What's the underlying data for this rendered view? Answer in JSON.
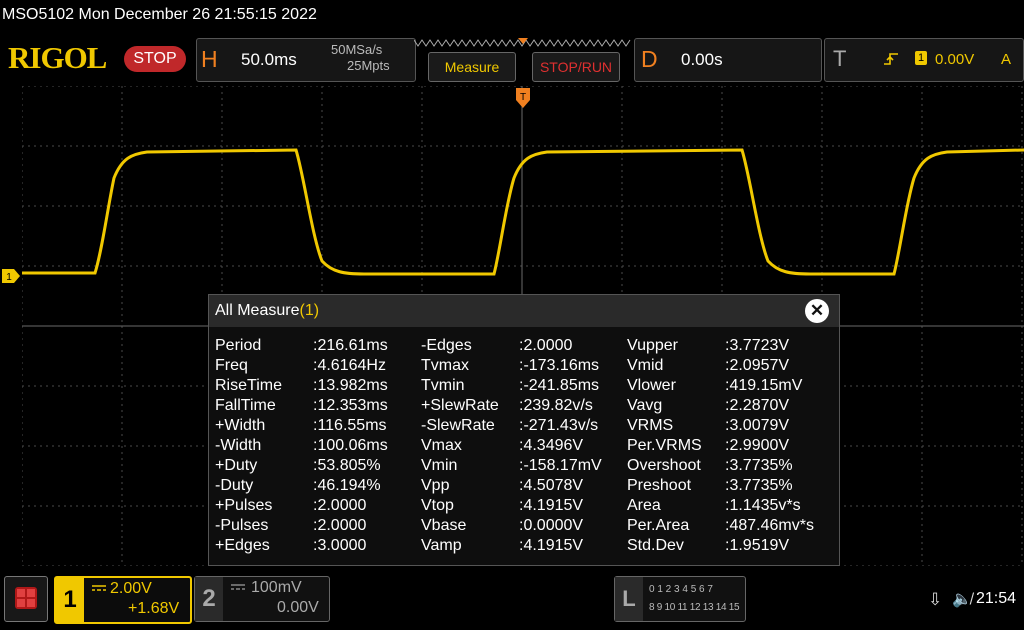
{
  "window_title": "MSO5102  Mon December 26 21:55:15 2022",
  "brand": "RIGOL",
  "run_state": "STOP",
  "horizontal": {
    "letter": "H",
    "timebase": "50.0ms",
    "sample_rate": "50MSa/s",
    "memory_depth": "25Mpts"
  },
  "buttons": {
    "measure": "Measure",
    "stop_run": "STOP/RUN"
  },
  "delay": {
    "letter": "D",
    "value": "0.00s"
  },
  "trigger": {
    "letter": "T",
    "source": "1",
    "level": "0.00V",
    "mode": "A"
  },
  "channel_marker": "1",
  "trigger_marker": "T",
  "colors": {
    "ch1": "#f0c800",
    "stop": "#c0282a",
    "accent": "#f08020",
    "grid": "#555555"
  },
  "measure_panel": {
    "title": "All Measure",
    "count": "(1)",
    "close": "✕",
    "columns": [
      [
        [
          "Period",
          ":216.61ms"
        ],
        [
          "Freq",
          ":4.6164Hz"
        ],
        [
          "RiseTime",
          ":13.982ms"
        ],
        [
          "FallTime",
          ":12.353ms"
        ],
        [
          "+Width",
          ":116.55ms"
        ],
        [
          "-Width",
          ":100.06ms"
        ],
        [
          "+Duty",
          ":53.805%"
        ],
        [
          "-Duty",
          ":46.194%"
        ],
        [
          "+Pulses",
          ":2.0000"
        ],
        [
          "-Pulses",
          ":2.0000"
        ],
        [
          "+Edges",
          ":3.0000"
        ]
      ],
      [
        [
          "-Edges",
          ":2.0000"
        ],
        [
          "Tvmax",
          ":-173.16ms"
        ],
        [
          "Tvmin",
          ":-241.85ms"
        ],
        [
          "+SlewRate",
          ":239.82v/s"
        ],
        [
          "-SlewRate",
          ":-271.43v/s"
        ],
        [
          "Vmax",
          ":4.3496V"
        ],
        [
          "Vmin",
          ":-158.17mV"
        ],
        [
          "Vpp",
          ":4.5078V"
        ],
        [
          "Vtop",
          ":4.1915V"
        ],
        [
          "Vbase",
          ":0.0000V"
        ],
        [
          "Vamp",
          ":4.1915V"
        ]
      ],
      [
        [
          "Vupper",
          ":3.7723V"
        ],
        [
          "Vmid",
          ":2.0957V"
        ],
        [
          "Vlower",
          ":419.15mV"
        ],
        [
          "Vavg",
          ":2.2870V"
        ],
        [
          "VRMS",
          ":3.0079V"
        ],
        [
          "Per.VRMS",
          ":2.9900V"
        ],
        [
          "Overshoot",
          ":3.7735%"
        ],
        [
          "Preshoot",
          ":3.7735%"
        ],
        [
          "Area",
          ":1.1435v*s"
        ],
        [
          "Per.Area",
          ":487.46mv*s"
        ],
        [
          "Std.Dev",
          ":1.9519V"
        ]
      ]
    ]
  },
  "channels": [
    {
      "number": "1",
      "scale": "2.00V",
      "offset": "+1.68V",
      "active": true
    },
    {
      "number": "2",
      "scale": "100mV",
      "offset": "0.00V",
      "active": false
    }
  ],
  "logic": {
    "letter": "L",
    "row1": "0 1 2 3  4 5 6 7",
    "row2": "8 9 10 11 12 13 14 15"
  },
  "status": {
    "usb": "⇩",
    "speaker": "🔈̸",
    "time": "21:54"
  }
}
